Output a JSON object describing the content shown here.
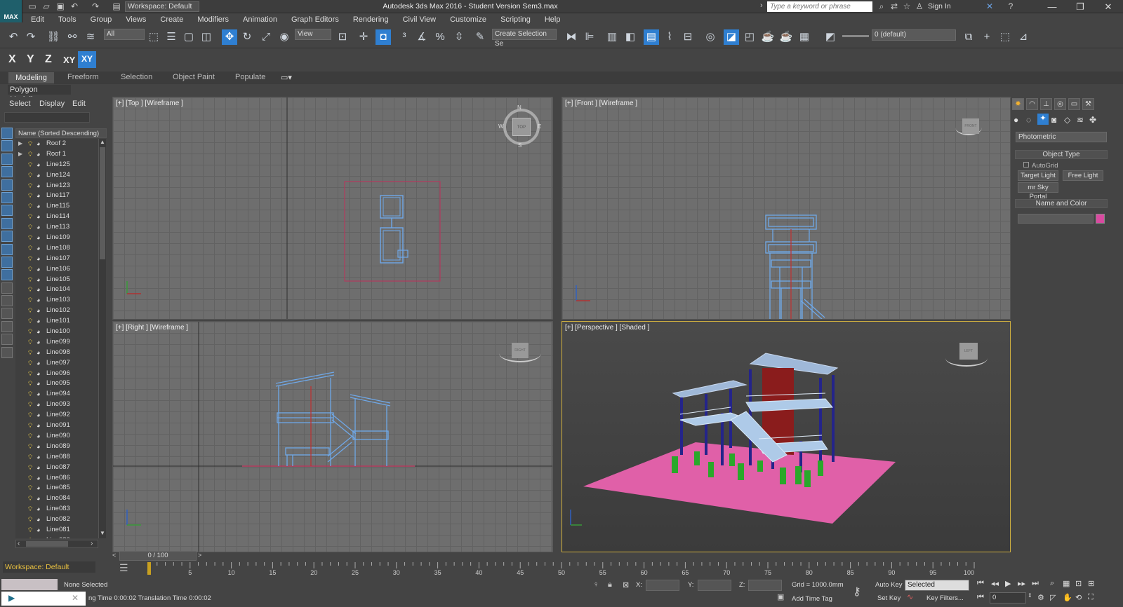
{
  "window": {
    "title": "Autodesk 3ds Max 2016 - Student Version     Sem3.max",
    "workspace": "Workspace: Default",
    "search_placeholder": "Type a keyword or phrase",
    "sign_in": "Sign In",
    "logo_text": "MAX"
  },
  "menu": [
    "Edit",
    "Tools",
    "Group",
    "Views",
    "Create",
    "Modifiers",
    "Animation",
    "Graph Editors",
    "Rendering",
    "Civil View",
    "Customize",
    "Scripting",
    "Help"
  ],
  "toolbar": {
    "filter": "All",
    "refcoord": "View",
    "selection_set": "Create Selection Se",
    "layer": "0 (default)"
  },
  "axis": {
    "x": "X",
    "y": "Y",
    "z": "Z",
    "xy": "XY",
    "xy2": "XY"
  },
  "ribbon": {
    "tabs": [
      "Modeling",
      "Freeform",
      "Selection",
      "Object Paint",
      "Populate"
    ],
    "active_panel": "Polygon Modeling"
  },
  "scene_explorer": {
    "tabs": [
      "Select",
      "Display",
      "Edit"
    ],
    "column_header": "Name (Sorted Descending)",
    "items": [
      "Roof 2",
      "Roof 1",
      "Line125",
      "Line124",
      "Line123",
      "Line117",
      "Line115",
      "Line114",
      "Line113",
      "Line109",
      "Line108",
      "Line107",
      "Line106",
      "Line105",
      "Line104",
      "Line103",
      "Line102",
      "Line101",
      "Line100",
      "Line099",
      "Line098",
      "Line097",
      "Line096",
      "Line095",
      "Line094",
      "Line093",
      "Line092",
      "Line091",
      "Line090",
      "Line089",
      "Line088",
      "Line087",
      "Line086",
      "Line085",
      "Line084",
      "Line083",
      "Line082",
      "Line081",
      "Line080"
    ]
  },
  "viewports": {
    "top": "[+] [Top ] [Wireframe ]",
    "front": "[+] [Front ] [Wireframe ]",
    "right": "[+] [Right ] [Wireframe ]",
    "perspective": "[+] [Perspective ] [Shaded ]"
  },
  "viewcube": {
    "top": "TOP",
    "front": "FRONT",
    "right": "RIGHT",
    "left": "LEFT",
    "compass": [
      "N",
      "E",
      "S",
      "W"
    ]
  },
  "command_panel": {
    "category": "Photometric",
    "object_type_header": "Object Type",
    "autogrid": "AutoGrid",
    "buttons": [
      "Target Light",
      "Free Light",
      "mr Sky Portal"
    ],
    "name_color_header": "Name and Color",
    "object_color": "#d94aa0"
  },
  "timeline": {
    "frame": "0 / 100",
    "ticks": [
      "0",
      "5",
      "10",
      "15",
      "20",
      "25",
      "30",
      "35",
      "40",
      "45",
      "50",
      "55",
      "60",
      "65",
      "70",
      "75",
      "80",
      "85",
      "90",
      "95",
      "100"
    ]
  },
  "status": {
    "selection": "None Selected",
    "prompt": "ng Time 0:00:02   Translation Time 0:00:02",
    "x_label": "X:",
    "y_label": "Y:",
    "z_label": "Z:",
    "grid": "Grid = 1000.0mm",
    "add_time_tag": "Add Time Tag",
    "auto_key": "Auto Key",
    "set_key": "Set Key",
    "key_mode": "Selected",
    "key_filters": "Key Filters...",
    "current_frame": "0",
    "workspace": "Workspace: Default"
  },
  "colors": {
    "wire": "#6fa8e8",
    "ground": "#e060a8",
    "column_green": "#2aa82a",
    "column_blue": "#24248a",
    "core_red": "#8a1c1c",
    "roof": "#9fb8d8",
    "active_viewport": "#d0b040"
  }
}
